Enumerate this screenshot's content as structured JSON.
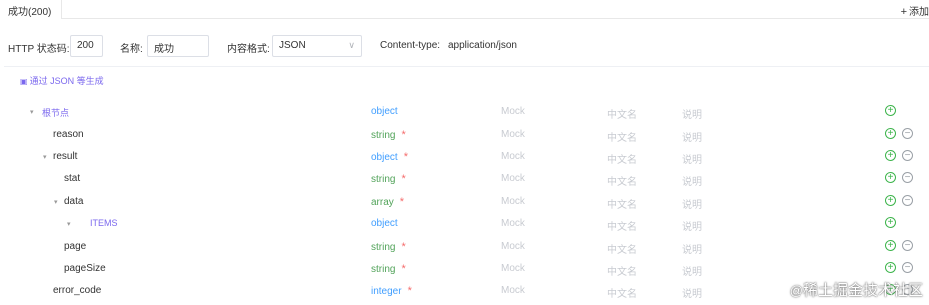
{
  "tab": {
    "label": "成功(200)"
  },
  "add_button": {
    "label": "添加"
  },
  "form": {
    "status_label": "HTTP 状态码:",
    "status_value": "200",
    "name_label": "名称:",
    "name_value": "成功",
    "content_format_label": "内容格式:",
    "content_format_value": "JSON",
    "content_type_label": "Content-type:",
    "content_type_value": "application/json"
  },
  "generate_button": {
    "label": "通过 JSON 等生成"
  },
  "placeholders": {
    "mock": "Mock",
    "cn_name": "中文名",
    "desc": "说明"
  },
  "rows": [
    {
      "name": "根节点",
      "type": "object",
      "required": false,
      "level": 0,
      "expandable": true,
      "deletable": false,
      "style": "root"
    },
    {
      "name": "reason",
      "type": "string",
      "required": true,
      "level": 1,
      "expandable": false,
      "deletable": true
    },
    {
      "name": "result",
      "type": "object",
      "required": true,
      "level": 1,
      "expandable": true,
      "deletable": true
    },
    {
      "name": "stat",
      "type": "string",
      "required": true,
      "level": 2,
      "expandable": false,
      "deletable": true
    },
    {
      "name": "data",
      "type": "array",
      "required": true,
      "level": 2,
      "expandable": true,
      "deletable": true
    },
    {
      "name": "ITEMS",
      "type": "object",
      "required": false,
      "level": 3,
      "expandable": true,
      "deletable": false,
      "style": "items"
    },
    {
      "name": "page",
      "type": "string",
      "required": true,
      "level": 2,
      "expandable": false,
      "deletable": true
    },
    {
      "name": "pageSize",
      "type": "string",
      "required": true,
      "level": 2,
      "expandable": false,
      "deletable": true
    },
    {
      "name": "error_code",
      "type": "integer",
      "required": true,
      "level": 1,
      "expandable": false,
      "deletable": true
    }
  ],
  "watermark": {
    "text": "稀土掘金技术社区",
    "at": "@"
  },
  "colors": {
    "accent": "#7b68ee",
    "type_blue": "#409eff",
    "type_green": "#52a35a",
    "required": "#f56c6c",
    "add": "#3cb44b"
  }
}
